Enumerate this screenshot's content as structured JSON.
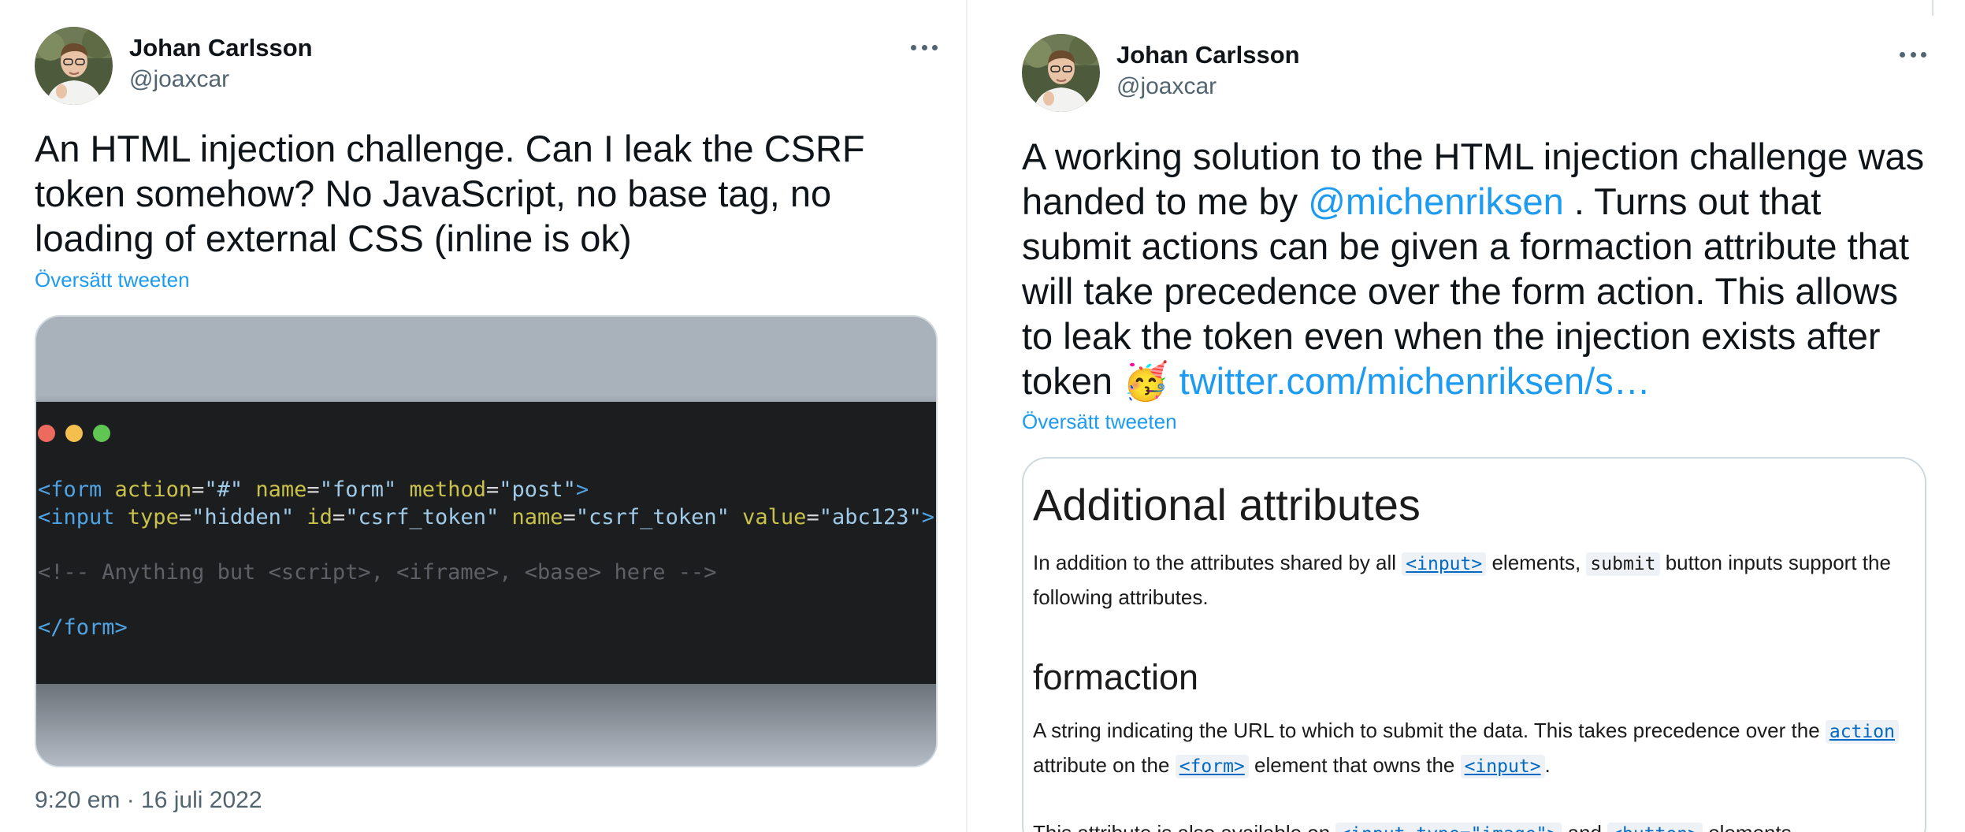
{
  "left_tweet": {
    "author_name": "Johan Carlsson",
    "author_handle": "@joaxcar",
    "text": "An HTML injection challenge. Can I leak the CSRF token somehow? No JavaScript, no base tag, no loading of external CSS (inline is ok)",
    "translate_label": "Översätt tweeten",
    "timestamp": "9:20 em · 16 juli 2022",
    "code_image": {
      "line1": {
        "open": "<form ",
        "a1": "action",
        "eq1": "=",
        "v1": "\"#\"",
        "a2": " name",
        "eq2": "=",
        "v2": "\"form\"",
        "a3": " method",
        "eq3": "=",
        "v3": "\"post\"",
        "close": ">"
      },
      "line2": {
        "open": "<input ",
        "a1": "type",
        "eq1": "=",
        "v1": "\"hidden\"",
        "a2": " id",
        "eq2": "=",
        "v2": "\"csrf_token\"",
        "a3": " name",
        "eq3": "=",
        "v3": "\"csrf_token\"",
        "a4": " value",
        "eq4": "=",
        "v4": "\"abc123\"",
        "close": ">"
      },
      "comment": "<!-- Anything but <script>, <iframe>, <base> here -->",
      "closing_tag": "</form>",
      "traffic_light_colors": [
        "#ed6a5e",
        "#f5bf4f",
        "#61c554"
      ]
    }
  },
  "right_tweet": {
    "author_name": "Johan Carlsson",
    "author_handle": "@joaxcar",
    "text_part1": "A working solution to the HTML injection challenge was handed to me by ",
    "mention": "@michenriksen",
    "text_part2": " . Turns out that submit actions can be given a formaction attribute that will take precedence over the form action. This allows to leak the token even when the injection exists after token ",
    "emoji": "🥳",
    "link": "twitter.com/michenriksen/s…",
    "translate_label": "Översätt tweeten",
    "doc_card": {
      "heading": "Additional attributes",
      "intro_before": "In addition to the attributes shared by all ",
      "intro_code1": "<input>",
      "intro_middle": " elements, ",
      "intro_code2": "submit",
      "intro_after": " button inputs support the",
      "intro_line2": "following attributes.",
      "subheading": "formaction",
      "desc_before": "A string indicating the URL to which to submit the data. This takes precedence over the ",
      "desc_code1": "action",
      "desc2_before": "attribute on the ",
      "desc_code2": "<form>",
      "desc2_middle": " element that owns the ",
      "desc_code3": "<input>",
      "desc2_after": ".",
      "also_before": "This attribute is also available on ",
      "also_code1": "<input type=\"image\">",
      "also_middle": " and ",
      "also_code2": "<button>",
      "also_after": " elements."
    }
  },
  "colors": {
    "accent_link": "#1d9bf0",
    "text_primary": "#0f1419",
    "text_secondary": "#536471"
  }
}
